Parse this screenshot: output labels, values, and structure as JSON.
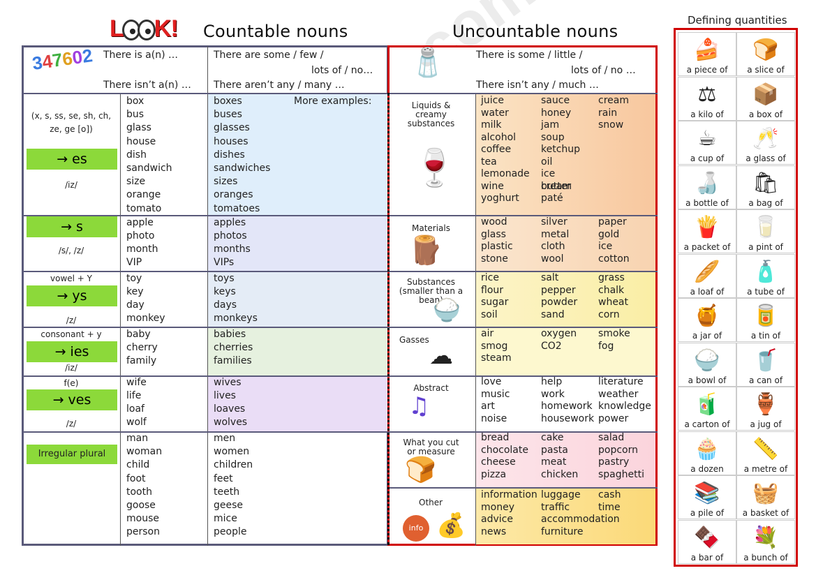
{
  "header": {
    "logo": "LOOK!",
    "countable_title": "Countable nouns",
    "uncountable_title": "Uncountable nouns"
  },
  "countable": {
    "header": {
      "there_is": "There is a(n) …",
      "there_isnt": "There isn’t a(n) …",
      "there_are_1": "There are some / few /",
      "there_are_2": "lots of / no…",
      "there_arent": "There aren’t any / many …"
    },
    "more_examples": "More examples:",
    "rules": [
      {
        "condition": "(x, s, ss, se, sh, ch, ze, ge [o])",
        "button": "→ es",
        "pron": "/iz/",
        "singular": [
          "box",
          "bus",
          "glass",
          "house",
          "dish",
          "sandwich",
          "size",
          "orange",
          "tomato"
        ],
        "plural": [
          "boxes",
          "buses",
          "glasses",
          "houses",
          "dishes",
          "sandwiches",
          "sizes",
          "oranges",
          "tomatoes"
        ]
      },
      {
        "condition": "",
        "button": "→ s",
        "pron": "/s/, /z/",
        "singular": [
          "apple",
          "photo",
          "month",
          "VIP"
        ],
        "plural": [
          "apples",
          "photos",
          "months",
          "VIPs"
        ]
      },
      {
        "condition": "vowel + Y",
        "button": "→ ys",
        "pron": "/z/",
        "singular": [
          "toy",
          "key",
          "day",
          "monkey"
        ],
        "plural": [
          "toys",
          "keys",
          "days",
          "monkeys"
        ]
      },
      {
        "condition": "consonant + y",
        "button": "→ ies",
        "pron": "/iz/",
        "singular": [
          "baby",
          "cherry",
          "family"
        ],
        "plural": [
          "babies",
          "cherries",
          "families"
        ]
      },
      {
        "condition": "f(e)",
        "button": "→ ves",
        "pron": "/z/",
        "singular": [
          "wife",
          "life",
          "loaf",
          "wolf"
        ],
        "plural": [
          "wives",
          "lives",
          "loaves",
          "wolves"
        ]
      },
      {
        "condition": "",
        "button": "Irregular plural",
        "pron": "",
        "singular": [
          "man",
          "woman",
          "child",
          "foot",
          "tooth",
          "goose",
          "mouse",
          "person"
        ],
        "plural": [
          "men",
          "women",
          "children",
          "feet",
          "teeth",
          "geese",
          "mice",
          "people"
        ]
      }
    ]
  },
  "uncountable": {
    "header": {
      "there_is_1": "There is some / little /",
      "there_is_2": "lots of / no …",
      "there_isnt": "There isn’t any / much …"
    },
    "categories": [
      {
        "name": "Liquids & creamy substances",
        "icon": "drinks-icon",
        "words": [
          "juice",
          "sauce",
          "cream",
          "water",
          "honey",
          "rain",
          "milk",
          "jam",
          "snow",
          "alcohol",
          "soup",
          "",
          "coffee",
          "ketchup",
          "",
          "tea",
          "oil",
          "",
          "lemonade",
          "ice cream",
          "",
          "wine",
          "butter",
          "",
          "yoghurt",
          "paté",
          ""
        ]
      },
      {
        "name": "Materials",
        "icon": "wood-paper-icon",
        "words": [
          "wood",
          "silver",
          "paper",
          "glass",
          "metal",
          "gold",
          "plastic",
          "cloth",
          "ice",
          "stone",
          "wool",
          "cotton"
        ]
      },
      {
        "name": "Substances (smaller than a bean)",
        "icon": "rice-bowl-icon",
        "words": [
          "rice",
          "salt",
          "grass",
          "flour",
          "pepper",
          "chalk",
          "sugar",
          "powder",
          "wheat",
          "soil",
          "sand",
          "corn"
        ]
      },
      {
        "name": "Gasses",
        "icon": "smog-icon",
        "words": [
          "air",
          "oxygen",
          "smoke",
          "smog",
          "CO2",
          "fog",
          "steam",
          "",
          ""
        ]
      },
      {
        "name": "Abstract",
        "icon": "music-notes-icon",
        "words": [
          "love",
          "help",
          "literature",
          "music",
          "work",
          "weather",
          "art",
          "homework",
          "knowledge",
          "noise",
          "housework",
          "power"
        ]
      },
      {
        "name": "What you cut or measure",
        "icon": "bread-scale-icon",
        "words": [
          "bread",
          "cake",
          "salad",
          "chocolate",
          "pasta",
          "popcorn",
          "cheese",
          "meat",
          "pastry",
          "pizza",
          "chicken",
          "spaghetti"
        ]
      },
      {
        "name": "Other",
        "icon": "info-money-icon",
        "words": [
          "information",
          "luggage",
          "cash",
          "money",
          "traffic",
          "time",
          "advice",
          "accommodation",
          "",
          "news",
          "furniture",
          ""
        ]
      }
    ]
  },
  "quantities": {
    "title": "Defining quantities",
    "items": [
      {
        "label": "a piece of",
        "icon": "🍰"
      },
      {
        "label": "a slice of",
        "icon": "🍞"
      },
      {
        "label": "a kilo of",
        "icon": "⚖"
      },
      {
        "label": "a box of",
        "icon": "📦"
      },
      {
        "label": "a cup of",
        "icon": "☕"
      },
      {
        "label": "a glass of",
        "icon": "🥂"
      },
      {
        "label": "a bottle of",
        "icon": "🍶"
      },
      {
        "label": "a bag of",
        "icon": "🛍"
      },
      {
        "label": "a packet of",
        "icon": "🍟"
      },
      {
        "label": "a pint of",
        "icon": "🥛"
      },
      {
        "label": "a loaf of",
        "icon": "🥖"
      },
      {
        "label": "a tube of",
        "icon": "🧴"
      },
      {
        "label": "a jar of",
        "icon": "🍯"
      },
      {
        "label": "a tin of",
        "icon": "🥫"
      },
      {
        "label": "a bowl of",
        "icon": "🍚"
      },
      {
        "label": "a can of",
        "icon": "🥤"
      },
      {
        "label": "a carton of",
        "icon": "🧃"
      },
      {
        "label": "a jug of",
        "icon": "🏺"
      },
      {
        "label": "a dozen",
        "icon": "🧁"
      },
      {
        "label": "a metre of",
        "icon": "📏"
      },
      {
        "label": "a pile of",
        "icon": "📚"
      },
      {
        "label": "a basket of",
        "icon": "🧺"
      },
      {
        "label": "a bar of",
        "icon": "🍫"
      },
      {
        "label": "a bunch of",
        "icon": "💐"
      }
    ]
  },
  "watermark": "ESLprintables.com"
}
